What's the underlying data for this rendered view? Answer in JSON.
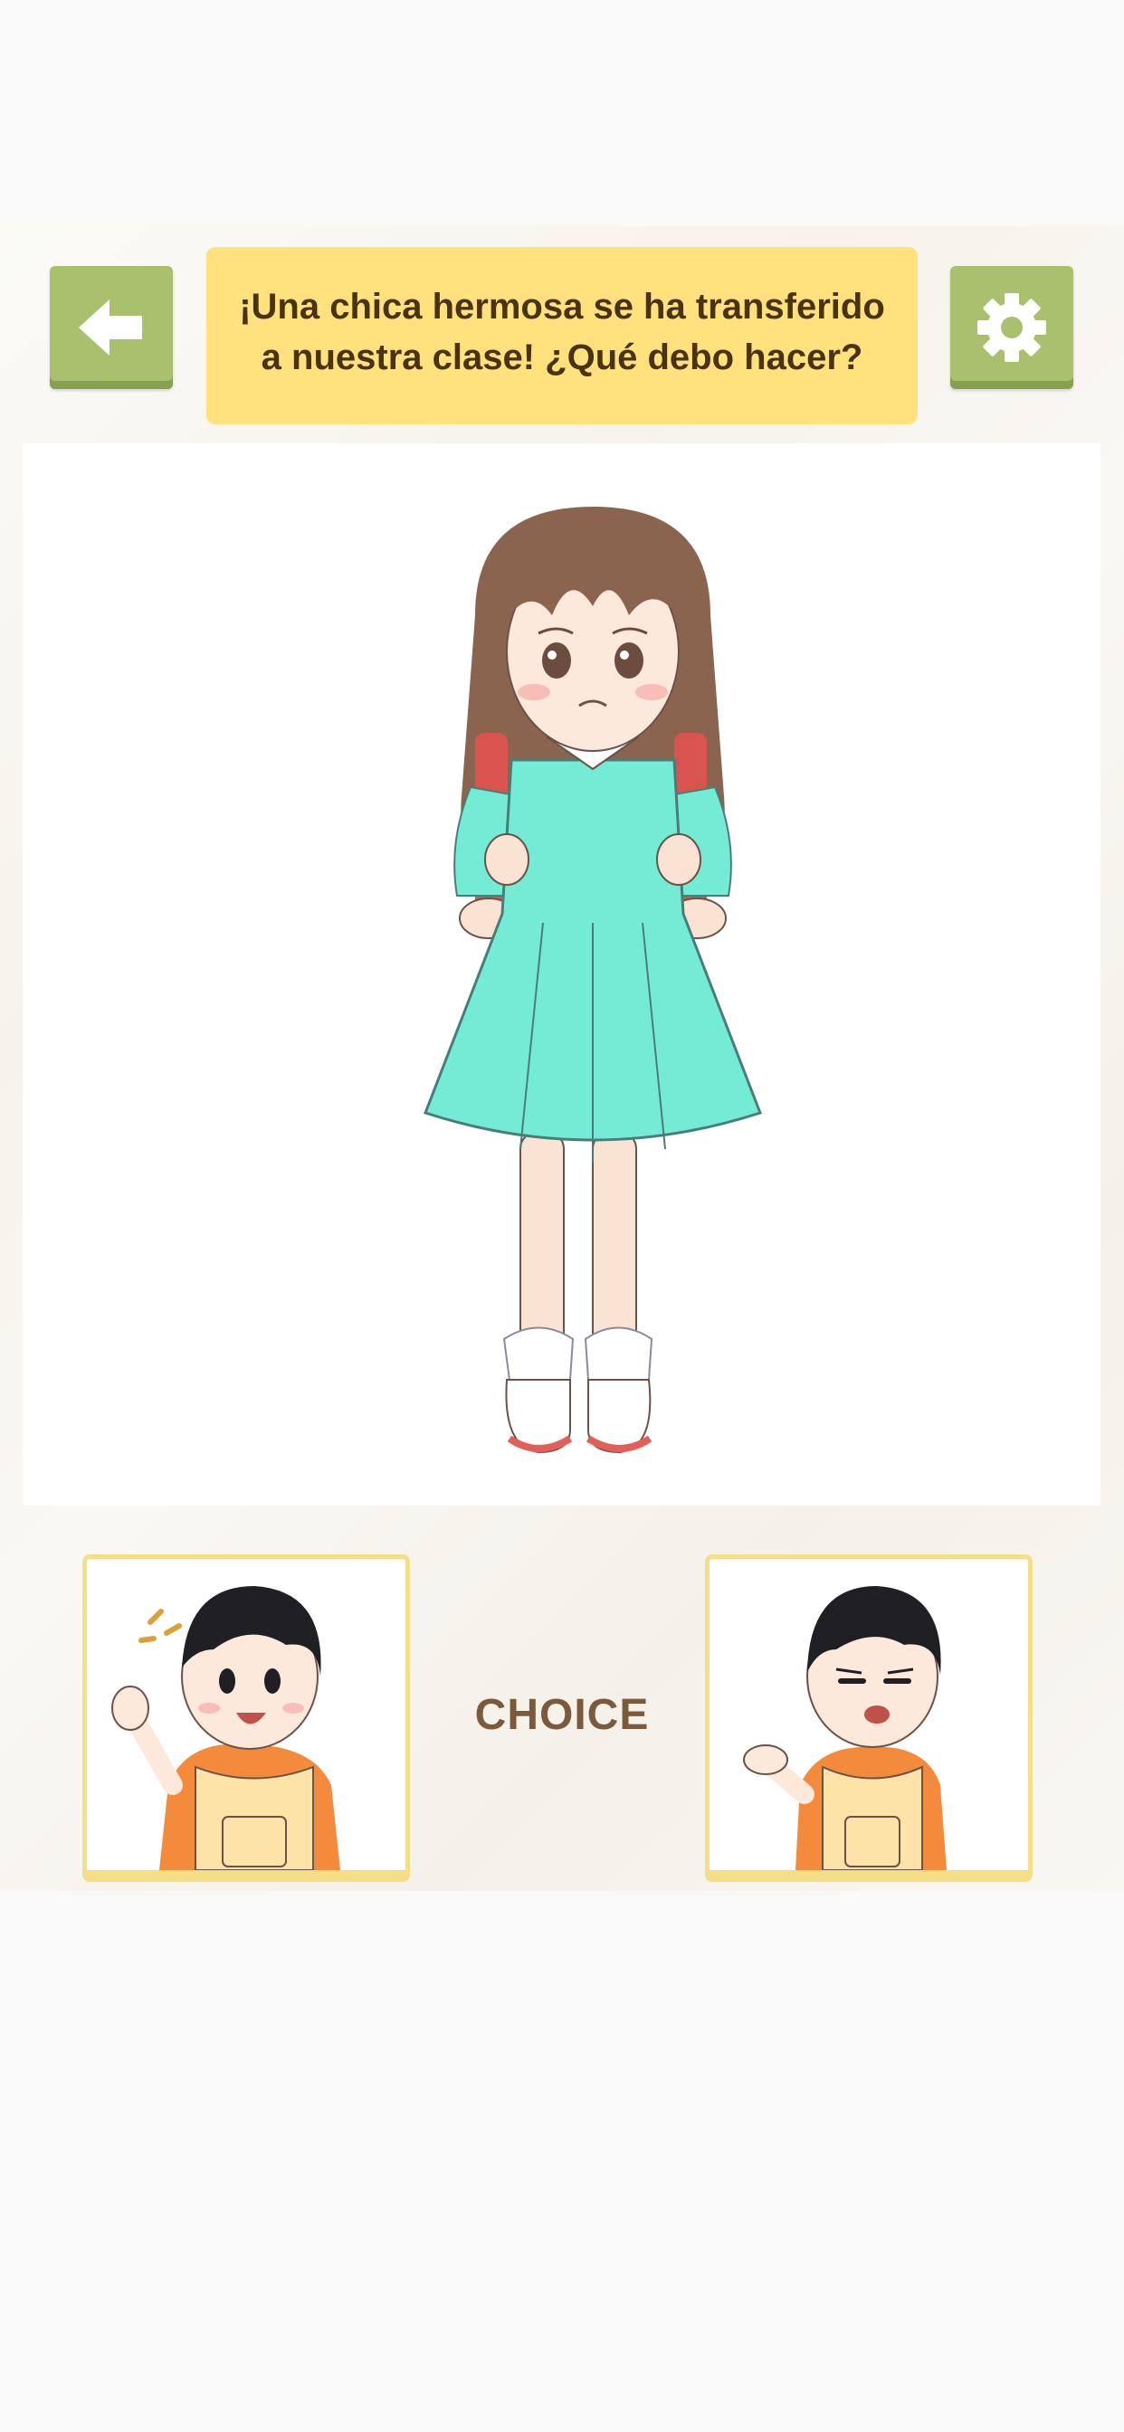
{
  "header": {
    "back_icon": "arrow-left-icon",
    "settings_icon": "gear-icon",
    "question": "¡Una chica hermosa se ha transferido a nuestra clase! ¿Qué debo hacer?"
  },
  "choices": {
    "label": "CHOICE",
    "left": {
      "image": "boy-waving-happy"
    },
    "right": {
      "image": "boy-shrugging-unimpressed"
    }
  },
  "scene": {
    "image": "shy-girl-with-backpack"
  },
  "colors": {
    "button_green": "#a9c06c",
    "question_bg": "#ffe17e",
    "question_text": "#4a3215",
    "card_border": "#f5df86",
    "choice_text": "#7b5a3c"
  }
}
